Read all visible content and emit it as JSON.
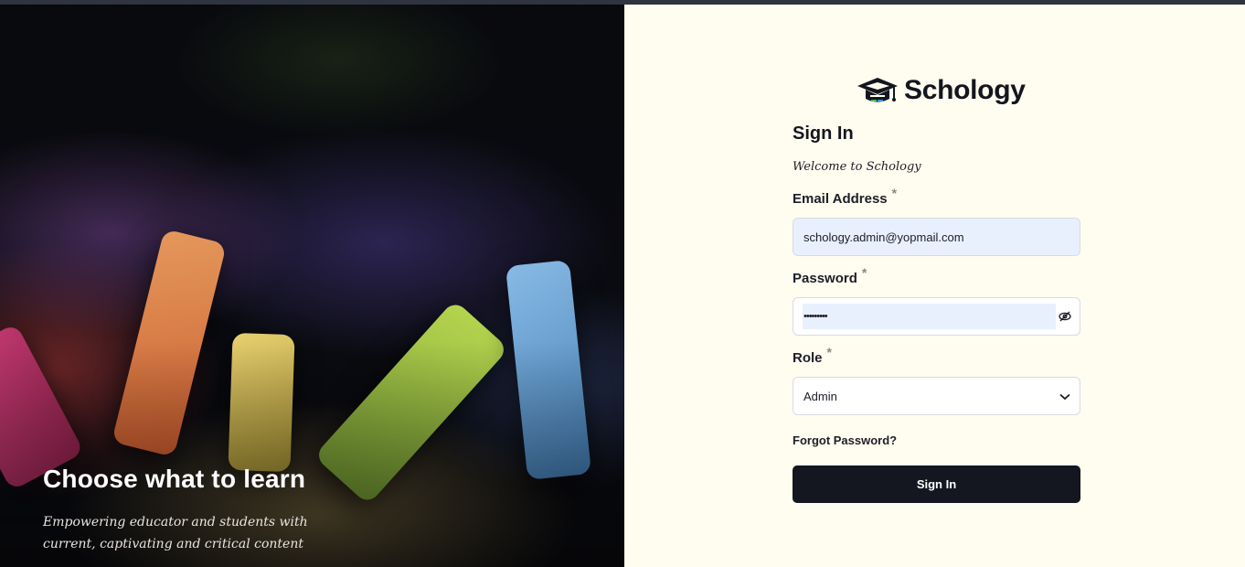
{
  "hero": {
    "title": "Choose what to learn",
    "subtitle": "Empowering educator and students with current, captivating and critical content"
  },
  "brand": {
    "name": "Schology",
    "logo_icon": "graduation-cap-icon"
  },
  "signin": {
    "title": "Sign In",
    "welcome": "Welcome to Schology",
    "email": {
      "label": "Email Address",
      "required_mark": "*",
      "value": "schology.admin@yopmail.com"
    },
    "password": {
      "label": "Password",
      "required_mark": "*",
      "masked_value": "•••••••••",
      "toggle_icon": "eye-off-icon"
    },
    "role": {
      "label": "Role",
      "required_mark": "*",
      "selected": "Admin",
      "dropdown_icon": "chevron-down-icon"
    },
    "forgot_password": "Forgot Password?",
    "submit_label": "Sign In"
  },
  "colors": {
    "panel_bg": "#fffcf0",
    "button_bg": "#141620",
    "autofill_bg": "#e8f0fe"
  }
}
